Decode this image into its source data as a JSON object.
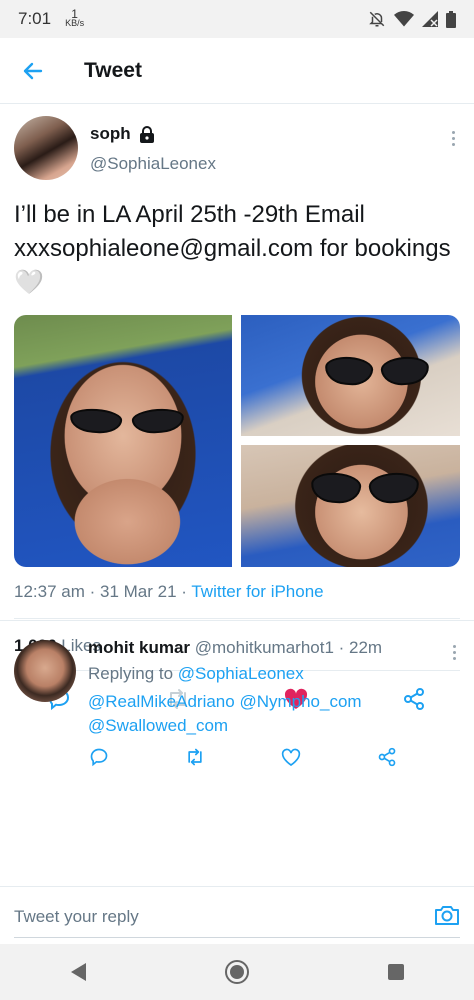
{
  "status_bar": {
    "time": "7:01",
    "net_speed_value": "1",
    "net_speed_unit": "KB/s"
  },
  "header": {
    "title": "Tweet",
    "back_icon": "arrow-left-icon"
  },
  "tweet": {
    "author_name": "soph",
    "author_handle": "@SophiaLeonex",
    "text": "I’ll be in LA April 25th -29th Email xxxsophialeone@gmail.com for bookings",
    "emoji": "🤍",
    "timestamp": "12:37 am · 31 Mar 21 ·",
    "source": "Twitter for iPhone",
    "likes_count": "1,026",
    "likes_label": "Likes",
    "liked": true
  },
  "reply": {
    "author_name": "mohit kumar",
    "author_handle_time": "@mohitkumarhot1 · 22m",
    "replying_to_label": "Replying to",
    "mentions": [
      "@SophiaLeonex",
      "@RealMikeAdriano",
      "@Nympho_com",
      "@Swallowed_com"
    ]
  },
  "compose": {
    "placeholder": "Tweet your reply"
  },
  "colors": {
    "accent": "#1da1f2",
    "like": "#e0245e",
    "muted": "#657786"
  }
}
